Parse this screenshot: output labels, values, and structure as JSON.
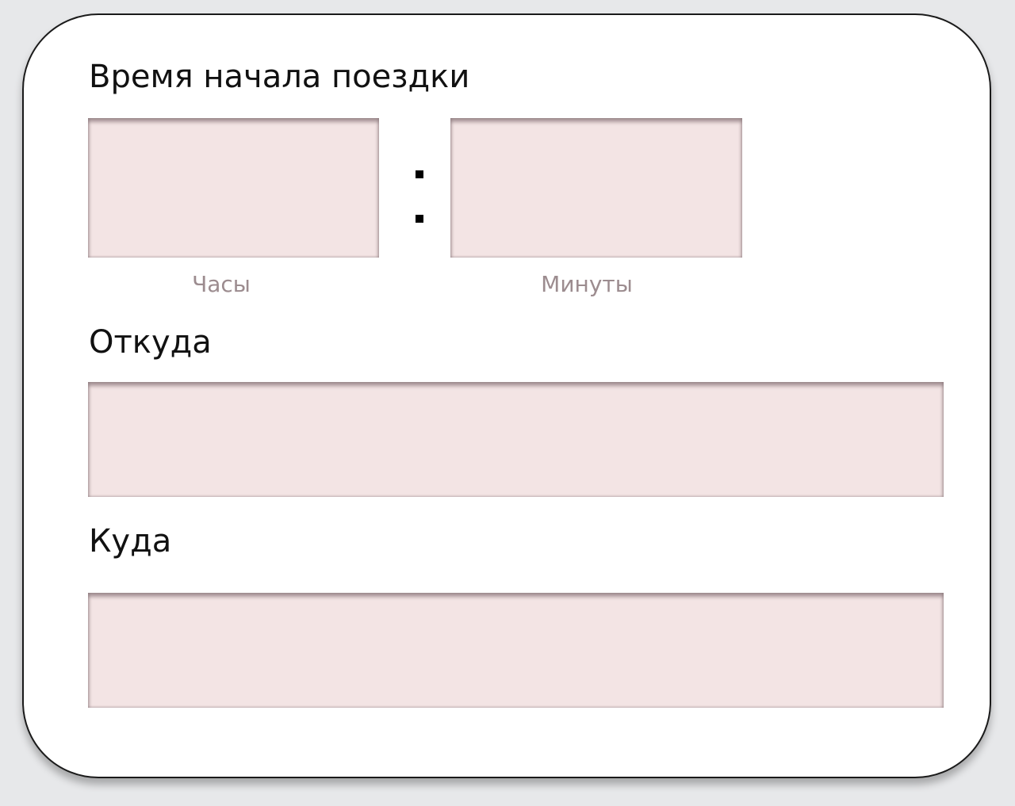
{
  "trip_start": {
    "title": "Время начала поездки",
    "hours": {
      "label": "Часы",
      "value": ""
    },
    "minutes": {
      "label": "Минуты",
      "value": ""
    },
    "separator": ":"
  },
  "from": {
    "title": "Откуда",
    "value": ""
  },
  "to": {
    "title": "Куда",
    "value": ""
  },
  "colors": {
    "page_background": "#e7e8ea",
    "card_background": "#ffffff",
    "field_background": "#f3e4e4",
    "sublabel_text": "#9c8c8f",
    "label_text": "#111111"
  }
}
